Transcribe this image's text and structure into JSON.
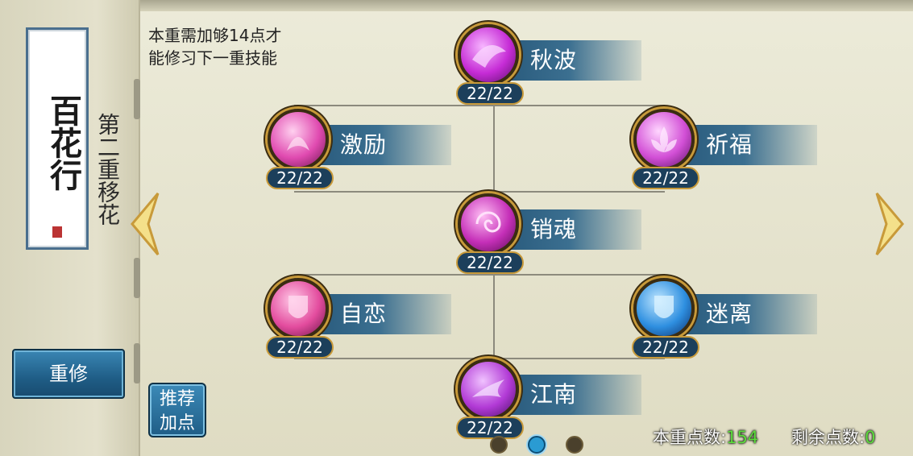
{
  "panel": {
    "title_card": "百花行",
    "layer_title": "第二重移花",
    "reset_label": "重修",
    "recommend_label_1": "推荐",
    "recommend_label_2": "加点"
  },
  "hint": {
    "line1": "本重需加够14点才",
    "line2": "能修习下一重技能"
  },
  "skills": [
    {
      "name": "秋波",
      "level": "22/22",
      "icon": "ribbon-orb-icon",
      "color": "#c62cd6"
    },
    {
      "name": "激励",
      "level": "22/22",
      "icon": "rose-orb-icon",
      "color": "#e04ab0"
    },
    {
      "name": "祈福",
      "level": "22/22",
      "icon": "lotus-orb-icon",
      "color": "#d24fd6"
    },
    {
      "name": "销魂",
      "level": "22/22",
      "icon": "spiral-orb-icon",
      "color": "#c52fb8"
    },
    {
      "name": "自恋",
      "level": "22/22",
      "icon": "shield-orb-icon",
      "color": "#e34c9e"
    },
    {
      "name": "迷离",
      "level": "22/22",
      "icon": "ice-shield-orb-icon",
      "color": "#2e8fe0"
    },
    {
      "name": "江南",
      "level": "22/22",
      "icon": "phoenix-orb-icon",
      "color": "#b23ad6"
    }
  ],
  "points": {
    "current_label": "本重点数:",
    "current_value": "154",
    "remaining_label": "剩余点数:",
    "remaining_value": "0"
  },
  "pager": {
    "pages": 3,
    "active_page": 2
  }
}
